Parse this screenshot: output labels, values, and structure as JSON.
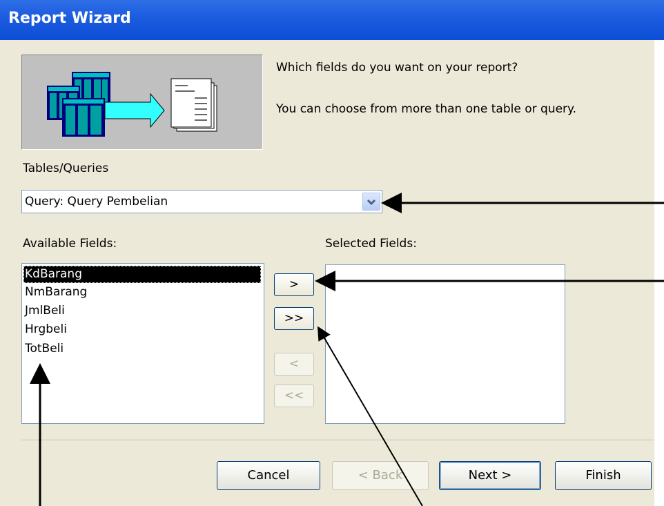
{
  "window": {
    "title": "Report Wizard"
  },
  "intro": {
    "question": "Which fields do you want on your report?",
    "hint": "You can choose from more than one table or query."
  },
  "tables_queries": {
    "label": "Tables/Queries",
    "selected": "Query: Query Pembelian"
  },
  "available": {
    "label": "Available Fields:",
    "items": [
      "KdBarang",
      "NmBarang",
      "JmlBeli",
      "Hrgbeli",
      "TotBeli"
    ],
    "selected_item": "KdBarang"
  },
  "selected_fields": {
    "label": "Selected Fields:",
    "items": []
  },
  "move_buttons": {
    "add_one": ">",
    "add_all": ">>",
    "remove_one": "<",
    "remove_all": "<<"
  },
  "footer": {
    "cancel": "Cancel",
    "back": "< Back",
    "next": "Next >",
    "finish": "Finish"
  },
  "icons": {
    "illustration": "tables-to-report-illustration",
    "dropdown": "chevron-down-icon"
  }
}
